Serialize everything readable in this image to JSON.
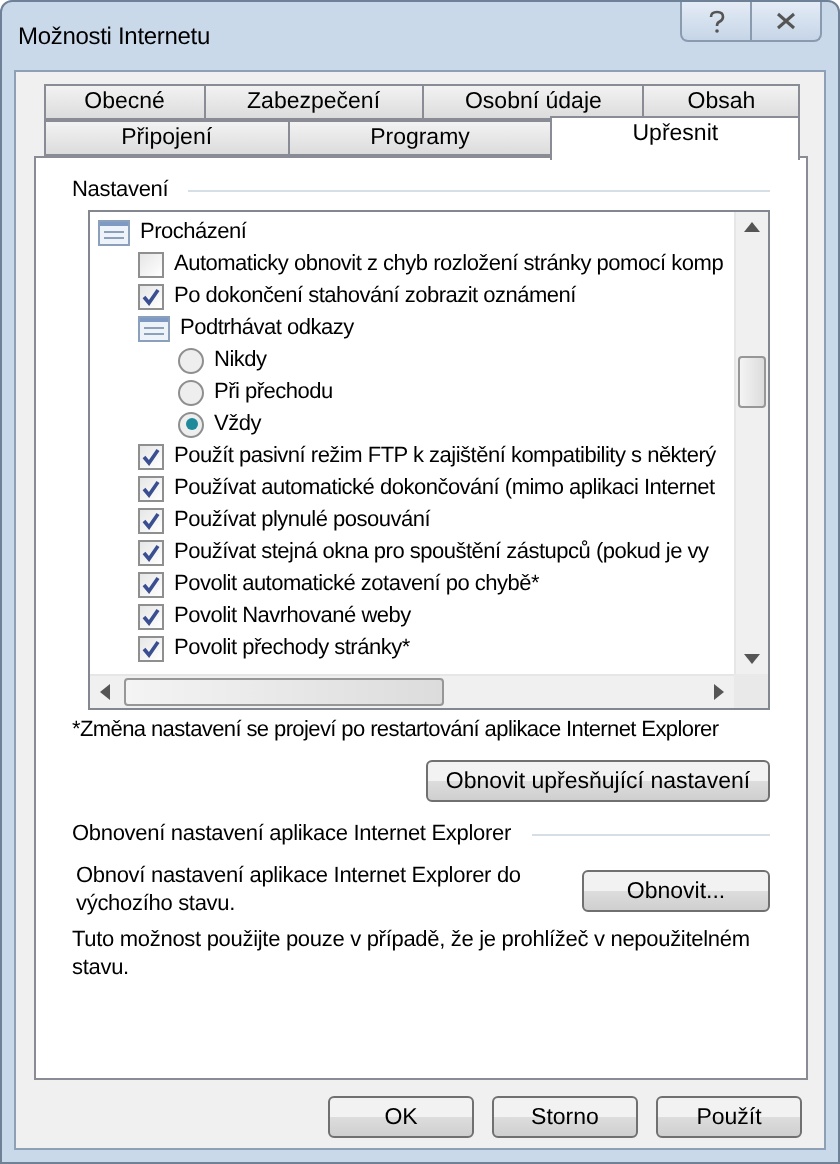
{
  "window": {
    "title": "Možnosti Internetu"
  },
  "tabs": [
    [
      {
        "label": "Obecné",
        "selected": false
      },
      {
        "label": "Zabezpečení",
        "selected": false
      },
      {
        "label": "Osobní údaje",
        "selected": false
      },
      {
        "label": "Obsah",
        "selected": false
      }
    ],
    [
      {
        "label": "Připojení",
        "selected": false
      },
      {
        "label": "Programy",
        "selected": false
      },
      {
        "label": "Upřesnit",
        "selected": true
      }
    ]
  ],
  "settings": {
    "label": "Nastavení",
    "items": [
      {
        "kind": "category",
        "label": "Procházení",
        "children": [
          {
            "kind": "checkbox",
            "label": "Automaticky obnovit z chyb rozložení stránky pomocí komp",
            "checked": false
          },
          {
            "kind": "checkbox",
            "label": "Po dokončení stahování zobrazit oznámení",
            "checked": true
          },
          {
            "kind": "category",
            "label": "Podtrhávat odkazy",
            "children": [
              {
                "kind": "radio",
                "label": "Nikdy",
                "selected": false
              },
              {
                "kind": "radio",
                "label": "Při přechodu",
                "selected": false
              },
              {
                "kind": "radio",
                "label": "Vždy",
                "selected": true
              }
            ]
          },
          {
            "kind": "checkbox",
            "label": "Použít pasivní režim FTP k zajištění kompatibility s některý",
            "checked": true
          },
          {
            "kind": "checkbox",
            "label": "Používat automatické dokončování (mimo aplikaci Internet",
            "checked": true
          },
          {
            "kind": "checkbox",
            "label": "Používat plynulé posouvání",
            "checked": true
          },
          {
            "kind": "checkbox",
            "label": "Používat stejná okna pro spouštění zástupců (pokud je vy",
            "checked": true
          },
          {
            "kind": "checkbox",
            "label": "Povolit automatické zotavení po chybě*",
            "checked": true
          },
          {
            "kind": "checkbox",
            "label": "Povolit Navrhované weby",
            "checked": true
          },
          {
            "kind": "checkbox",
            "label": "Povolit přechody stránky*",
            "checked": true
          }
        ]
      }
    ],
    "footnote": "*Změna nastavení se projeví po restartování aplikace Internet Explorer",
    "reset_advanced_button": "Obnovit upřesňující nastavení"
  },
  "reset": {
    "label": "Obnovení nastavení aplikace Internet Explorer",
    "description": "Obnoví nastavení aplikace Internet Explorer do výchozího stavu.",
    "button": "Obnovit...",
    "note": "Tuto možnost použijte pouze v případě, že je prohlížeč v nepoužitelném stavu."
  },
  "buttons": [
    "OK",
    "Storno",
    "Použít"
  ]
}
